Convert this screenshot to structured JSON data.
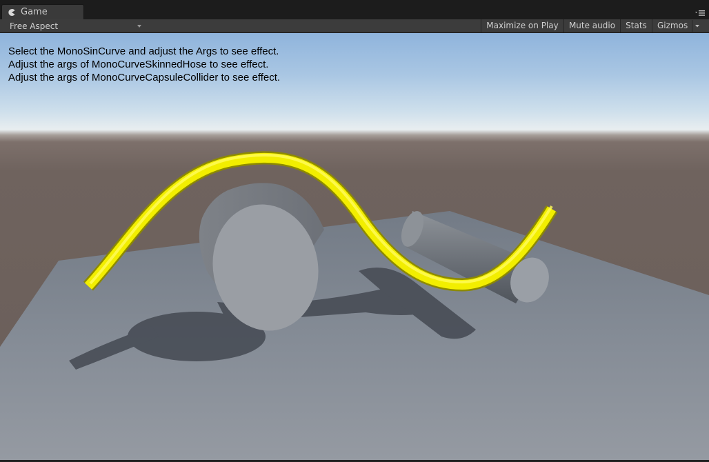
{
  "window": {
    "tab_label": "Game",
    "tab_icon": "pacman-icon",
    "menu_icon": "panel-menu-icon"
  },
  "toolbar": {
    "aspect_value": "Free Aspect",
    "maximize_label": "Maximize on Play",
    "mute_label": "Mute audio",
    "stats_label": "Stats",
    "gizmos_label": "Gizmos"
  },
  "viewport": {
    "instructions": [
      "Select the MonoSinCurve and adjust the Args to see effect.",
      "Adjust the args of MonoCurveSkinnedHose to see effect.",
      "Adjust the args of MonoCurveCapsuleCollider to see effect."
    ],
    "colors": {
      "hose": "#f5f000",
      "plane": "#8a9099",
      "cylinder": "#9a9ea4"
    }
  }
}
